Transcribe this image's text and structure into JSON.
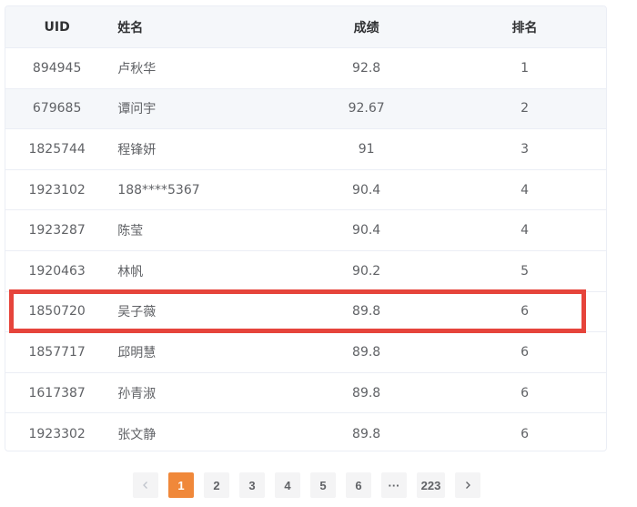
{
  "table": {
    "columns": [
      "UID",
      "姓名",
      "成绩",
      "排名"
    ],
    "rows": [
      {
        "uid": "894945",
        "name": "卢秋华",
        "score": "92.8",
        "rank": "1"
      },
      {
        "uid": "679685",
        "name": "谭问宇",
        "score": "92.67",
        "rank": "2"
      },
      {
        "uid": "1825744",
        "name": "程锋妍",
        "score": "91",
        "rank": "3"
      },
      {
        "uid": "1923102",
        "name": "188****5367",
        "score": "90.4",
        "rank": "4"
      },
      {
        "uid": "1923287",
        "name": "陈莹",
        "score": "90.4",
        "rank": "4"
      },
      {
        "uid": "1920463",
        "name": "林帆",
        "score": "90.2",
        "rank": "5"
      },
      {
        "uid": "1850720",
        "name": "吴子薇",
        "score": "89.8",
        "rank": "6"
      },
      {
        "uid": "1857717",
        "name": "邱明慧",
        "score": "89.8",
        "rank": "6"
      },
      {
        "uid": "1617387",
        "name": "孙青淑",
        "score": "89.8",
        "rank": "6"
      },
      {
        "uid": "1923302",
        "name": "张文静",
        "score": "89.8",
        "rank": "6"
      }
    ],
    "highlighted_row": 6
  },
  "pagination": {
    "prev_icon": "chevron-left-icon",
    "next_icon": "chevron-right-icon",
    "pages": [
      "1",
      "2",
      "3",
      "4",
      "5",
      "6",
      "···",
      "223"
    ],
    "active_page": "1"
  },
  "colors": {
    "highlight_border": "#e6443b",
    "active_page": "#f0883a",
    "header_bg": "#f5f7fa"
  }
}
